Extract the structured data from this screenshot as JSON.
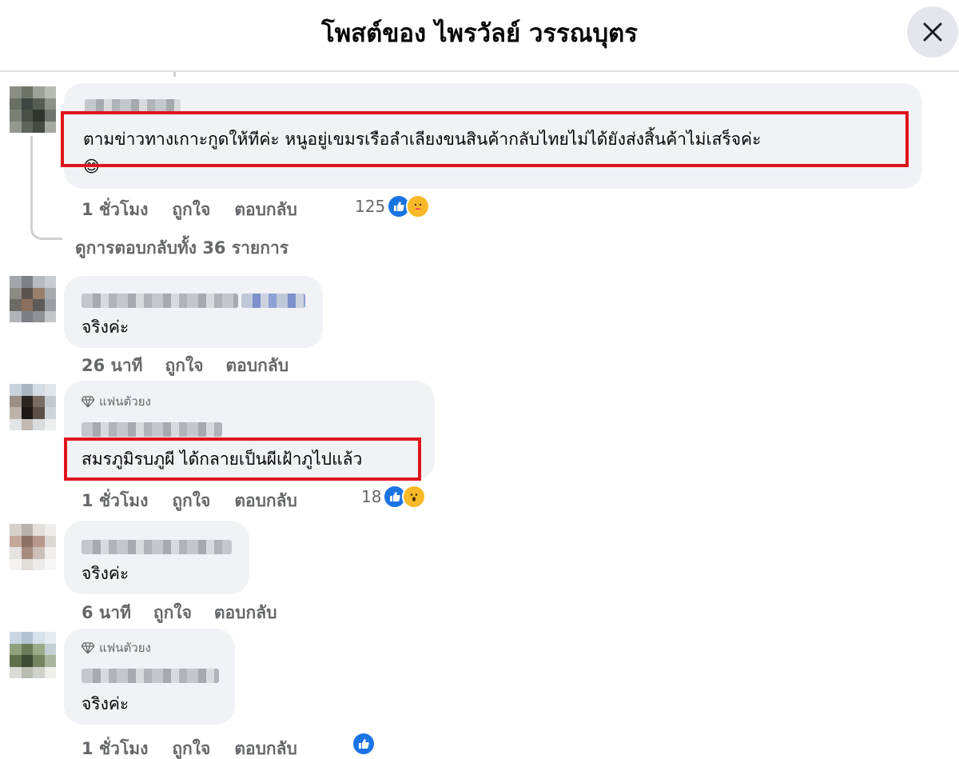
{
  "header": {
    "title": "โพสต์ของ ไพรวัลย์ วรรณบุตร",
    "close_icon": "close-icon"
  },
  "comments": [
    {
      "text": "ตามข่าวทางเกาะกูดให้ทีค่ะ หนูอยู่เขมรเรือลำเลียงขนสินค้ากลับไทยไม่ได้ยังส่งสิ้นค้าไม่เสร็จค่ะ",
      "emoji": "😊",
      "time": "1 ชั่วโมง",
      "like": "ถูกใจ",
      "reply": "ตอบกลับ",
      "reaction_count": "125",
      "reactions": [
        "like-icon",
        "care-icon"
      ],
      "view_replies": "ดูการตอบกลับทั้ง 36 รายการ"
    },
    {
      "text": "จริงค่ะ",
      "time": "26 นาที",
      "like": "ถูกใจ",
      "reply": "ตอบกลับ"
    },
    {
      "badge": "แฟนตัวยง",
      "text": "สมรภูมิรบภูผี ได้กลายเป็นผีเฝ้าภูไปแล้ว",
      "time": "1 ชั่วโมง",
      "like": "ถูกใจ",
      "reply": "ตอบกลับ",
      "reaction_count": "18",
      "reactions": [
        "like-icon",
        "wow-icon"
      ]
    },
    {
      "text": "จริงค่ะ",
      "time": "6 นาที",
      "like": "ถูกใจ",
      "reply": "ตอบกลับ"
    },
    {
      "badge": "แฟนตัวยง",
      "text": "จริงค่ะ",
      "time": "1 ชั่วโมง",
      "like": "ถูกใจ",
      "reply": "ตอบกลับ",
      "reactions": [
        "like-icon"
      ]
    }
  ],
  "colors": {
    "highlight": "#e0141b",
    "like_blue": "#1b74e4",
    "bubble_bg": "#f0f2f5",
    "secondary_text": "#65676b"
  }
}
